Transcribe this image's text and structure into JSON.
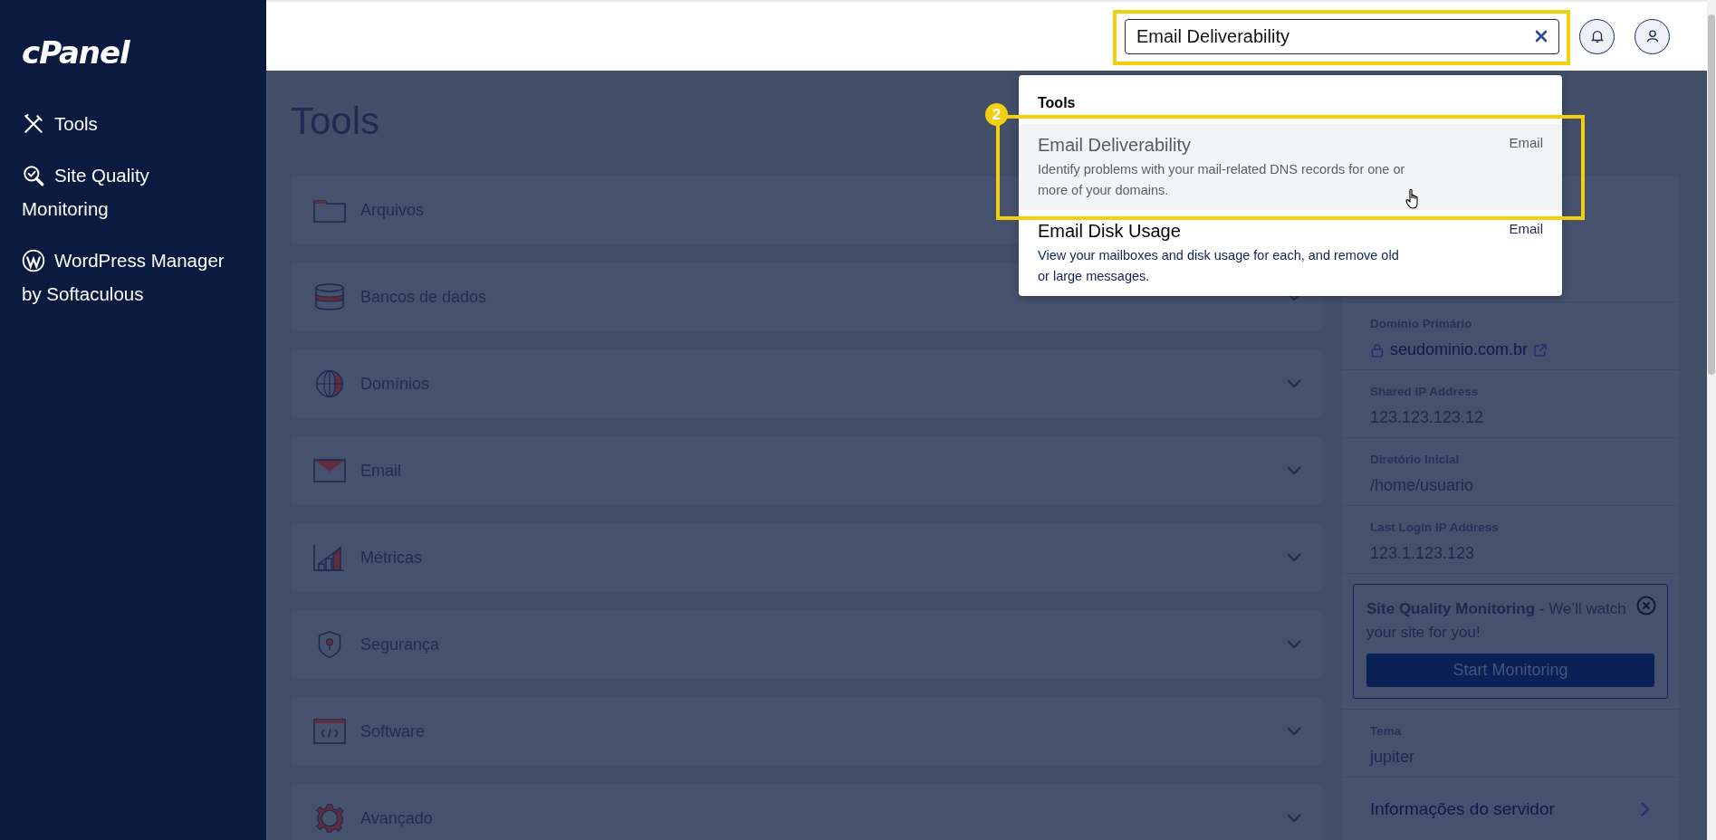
{
  "sidebar": {
    "logo": "cPanel",
    "items": [
      {
        "kind": "tools",
        "label": "Tools"
      },
      {
        "kind": "search-check",
        "label": "Site Quality Monitoring"
      },
      {
        "kind": "wp",
        "label": "WordPress Manager by Softaculous"
      }
    ]
  },
  "search": {
    "value": "Email Deliverability"
  },
  "search_results": {
    "heading": "Tools",
    "results": [
      {
        "title": "Email Deliverability",
        "description": "Identify problems with your mail-related DNS records for one or more of your domains.",
        "category": "Email",
        "selected": true
      },
      {
        "title": "Email Disk Usage",
        "description": "View your mailboxes and disk usage for each, and remove old or large messages.",
        "category": "Email",
        "selected": false
      }
    ]
  },
  "step_badge": "2",
  "tools": {
    "title": "Tools",
    "groups": [
      {
        "kind": "folder",
        "label": "Arquivos"
      },
      {
        "kind": "database",
        "label": "Bancos de dados"
      },
      {
        "kind": "globe",
        "label": "Domínios"
      },
      {
        "kind": "envelope",
        "label": "Email"
      },
      {
        "kind": "chart",
        "label": "Métricas"
      },
      {
        "kind": "shield",
        "label": "Segurança"
      },
      {
        "kind": "code",
        "label": "Software"
      },
      {
        "kind": "gear",
        "label": "Avançado"
      }
    ]
  },
  "info_panel": {
    "sections": [
      {
        "kind": "link",
        "label": "Domínio Primário",
        "value": "seudominio.com.br"
      },
      {
        "kind": "text",
        "label": "Shared IP Address",
        "value": "123.123.123.12"
      },
      {
        "kind": "text",
        "label": "Diretório Inicial",
        "value": "/home/usuario"
      },
      {
        "kind": "text",
        "label": "Last Login IP Address",
        "value": "123.1.123.123"
      },
      {
        "kind": "promo",
        "text": "**Site Quality Monitoring** - We’ll watch your site for you!",
        "button": "Start Monitoring"
      },
      {
        "kind": "text",
        "label": "Tema",
        "value": "jupiter"
      },
      {
        "kind": "nav",
        "value": "Informações do servidor"
      }
    ]
  }
}
